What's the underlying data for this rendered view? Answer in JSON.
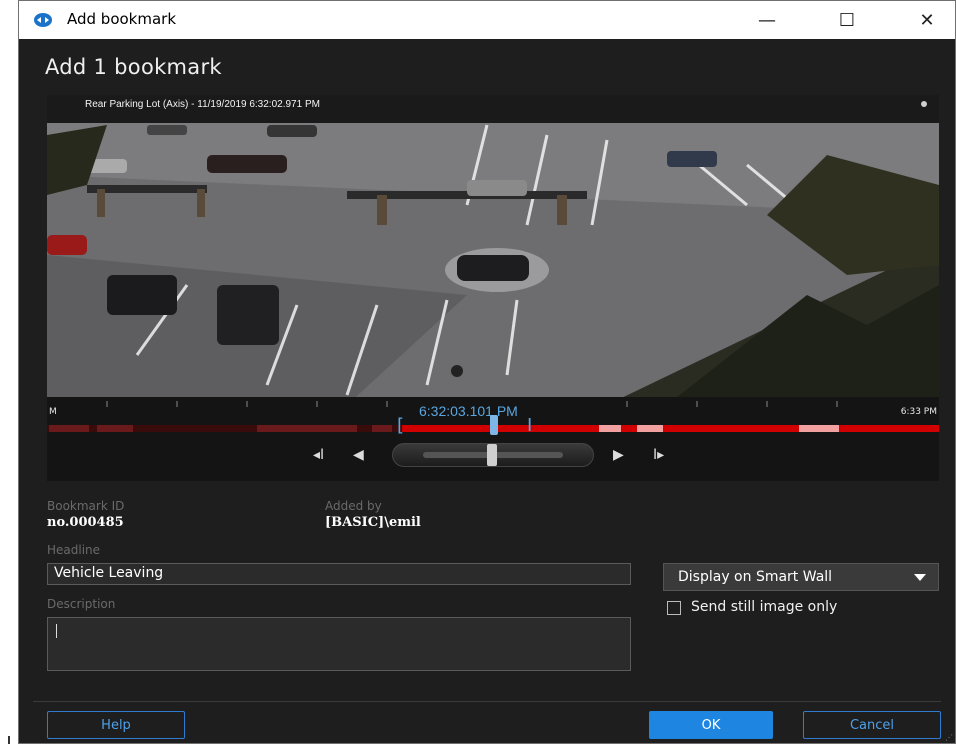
{
  "window": {
    "title": "Add bookmark",
    "min_glyph": "—",
    "max_glyph": "☐",
    "close_glyph": "✕"
  },
  "dialog": {
    "title": "Add 1 bookmark"
  },
  "video": {
    "overlay_label": "Rear Parking Lot (Axis) - 11/19/2019 6:32:02.971 PM"
  },
  "timeline": {
    "current_time": "6:32:03.101 PM",
    "left_edge_label": "M",
    "right_edge_label": "6:33 PM",
    "accent_color": "#5aa6e0",
    "segment_color": "#d00000",
    "highlight_color": "#f3a0a0"
  },
  "fields": {
    "bookmark_id_label": "Bookmark ID",
    "bookmark_id_value": "no.000485",
    "added_by_label": "Added by",
    "added_by_value": "[BASIC]\\emil",
    "headline_label": "Headline",
    "headline_value": "Vehicle Leaving",
    "description_label": "Description",
    "description_value": ""
  },
  "smartwall": {
    "label": "Display on Smart Wall",
    "icon": "chevron-down-icon"
  },
  "still_image": {
    "label": "Send still image only",
    "checked": false
  },
  "buttons": {
    "help": "Help",
    "ok": "OK",
    "cancel": "Cancel"
  },
  "colors": {
    "background": "#1e1e1e",
    "primary": "#1e86e0",
    "link": "#4ea0ea"
  }
}
